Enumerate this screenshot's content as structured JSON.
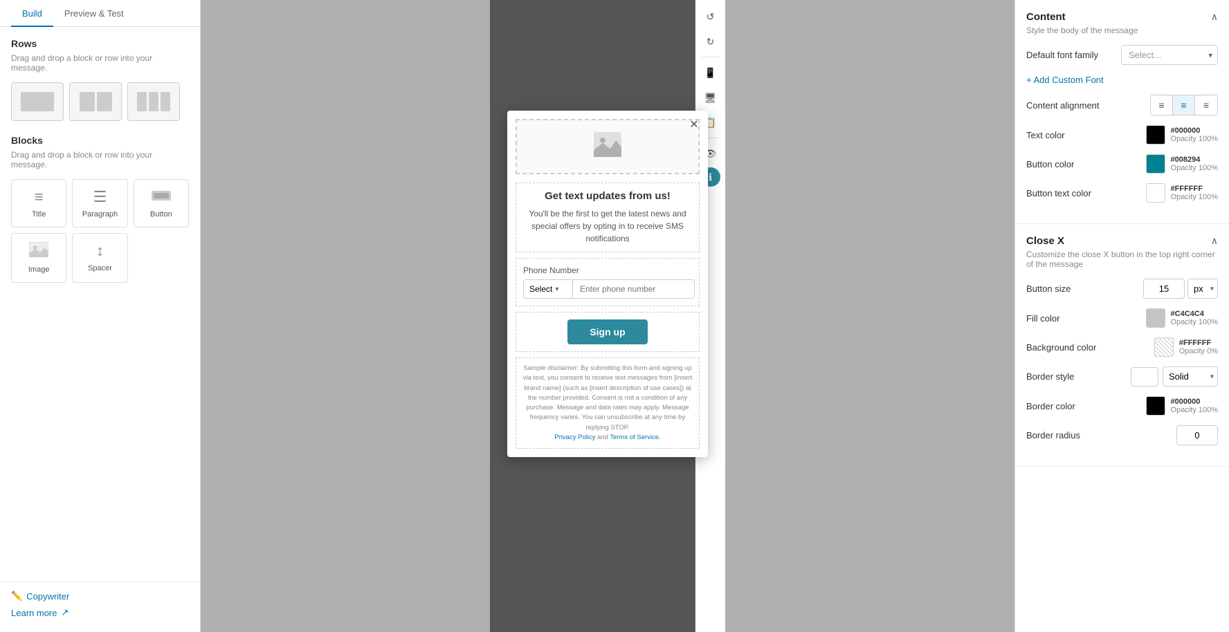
{
  "tabs": {
    "build": "Build",
    "preview": "Preview & Test"
  },
  "left": {
    "rows_title": "Rows",
    "rows_desc": "Drag and drop a block or row into your message.",
    "blocks_title": "Blocks",
    "blocks_desc": "Drag and drop a block or row into your message.",
    "blocks": [
      {
        "label": "Title",
        "icon": "≡"
      },
      {
        "label": "Paragraph",
        "icon": "☰"
      },
      {
        "label": "Button",
        "icon": "▭"
      },
      {
        "label": "Image",
        "icon": "🖼"
      },
      {
        "label": "Spacer",
        "icon": "↕"
      }
    ],
    "copywriter_label": "Copywriter",
    "learn_more": "Learn more"
  },
  "popup": {
    "heading": "Get text updates from us!",
    "subtext": "You'll be the first to get the latest news and special offers by opting in to receive SMS notifications",
    "phone_label": "Phone Number",
    "phone_select": "Select",
    "phone_placeholder": "Enter phone number",
    "button_label": "Sign up",
    "disclaimer": "Sample disclaimer: By submitting this form and signing up via text, you consent to receive text messages from [insert brand name] (such as [insert description of use cases]) at the number provided. Consent is not a condition of any purchase. Message and data rates may apply. Message frequency varies. You can unsubscribe at any time by replying STOP.",
    "privacy_policy": "Privacy Policy",
    "and_text": "and",
    "terms": "Terms of Service."
  },
  "right": {
    "content_title": "Content",
    "content_desc": "Style the body of the message",
    "default_font_label": "Default font family",
    "font_select_placeholder": "Select...",
    "add_custom_font": "+ Add Custom Font",
    "content_alignment_label": "Content alignment",
    "text_color_label": "Text color",
    "text_color_hex": "#000000",
    "text_color_opacity": "Opacity 100%",
    "button_color_label": "Button color",
    "button_color_hex": "#008294",
    "button_color_opacity": "Opacity 100%",
    "button_text_color_label": "Button text color",
    "button_text_color_hex": "#FFFFFF",
    "button_text_color_opacity": "Opacity 100%",
    "close_x_title": "Close X",
    "close_x_desc": "Customize the close X button in the top right corner of the message",
    "button_size_label": "Button size",
    "button_size_value": "15",
    "button_size_unit": "px",
    "fill_color_label": "Fill color",
    "fill_color_hex": "#C4C4C4",
    "fill_color_opacity": "Opacity 100%",
    "bg_color_label": "Background color",
    "bg_color_hex": "#FFFFFF",
    "bg_color_opacity": "Opacity 0%",
    "border_style_label": "Border style",
    "border_style_value": "Solid",
    "border_color_label": "Border color",
    "border_color_hex": "#000000",
    "border_color_opacity": "Opacity 100%",
    "border_radius_label": "Border radius",
    "border_radius_value": "0"
  }
}
